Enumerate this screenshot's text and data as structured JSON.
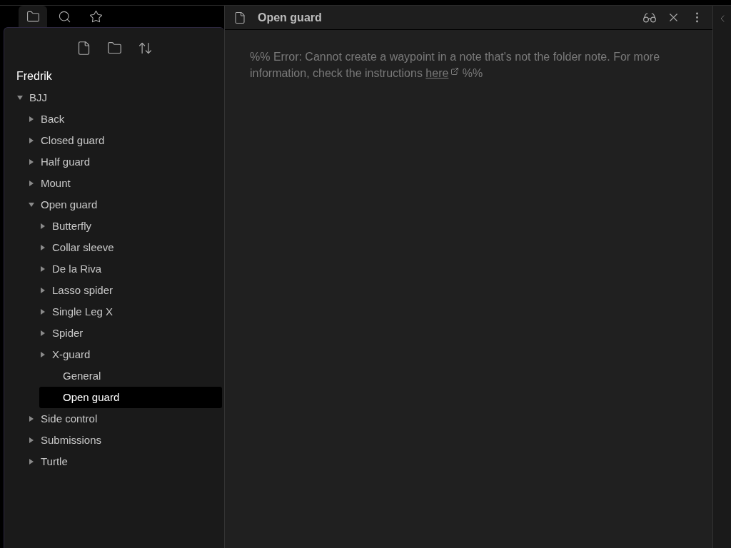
{
  "sidebar": {
    "tabs": [
      {
        "selected": true
      },
      {
        "selected": false
      },
      {
        "selected": false
      }
    ],
    "vault_name": "Fredrik",
    "tree": [
      {
        "kind": "folder",
        "label": "BJJ",
        "expanded": true,
        "children": [
          {
            "kind": "folder",
            "label": "Back",
            "expanded": false
          },
          {
            "kind": "folder",
            "label": "Closed guard",
            "expanded": false
          },
          {
            "kind": "folder",
            "label": "Half guard",
            "expanded": false
          },
          {
            "kind": "folder",
            "label": "Mount",
            "expanded": false
          },
          {
            "kind": "folder",
            "label": "Open guard",
            "expanded": true,
            "children": [
              {
                "kind": "folder",
                "label": "Butterfly",
                "expanded": false
              },
              {
                "kind": "folder",
                "label": "Collar sleeve",
                "expanded": false
              },
              {
                "kind": "folder",
                "label": "De la Riva",
                "expanded": false
              },
              {
                "kind": "folder",
                "label": "Lasso spider",
                "expanded": false
              },
              {
                "kind": "folder",
                "label": "Single Leg X",
                "expanded": false
              },
              {
                "kind": "folder",
                "label": "Spider",
                "expanded": false
              },
              {
                "kind": "folder",
                "label": "X-guard",
                "expanded": false
              },
              {
                "kind": "file",
                "label": "General",
                "selected": false
              },
              {
                "kind": "file",
                "label": "Open guard",
                "selected": true
              }
            ]
          },
          {
            "kind": "folder",
            "label": "Side control",
            "expanded": false
          },
          {
            "kind": "folder",
            "label": "Submissions",
            "expanded": false
          },
          {
            "kind": "folder",
            "label": "Turtle",
            "expanded": false
          }
        ]
      }
    ]
  },
  "editor": {
    "title": "Open guard",
    "message": {
      "before": "%% Error: Cannot create a waypoint in a note that's not the folder note. For more information, check the instructions",
      "link": "here",
      "after": "%%"
    }
  }
}
